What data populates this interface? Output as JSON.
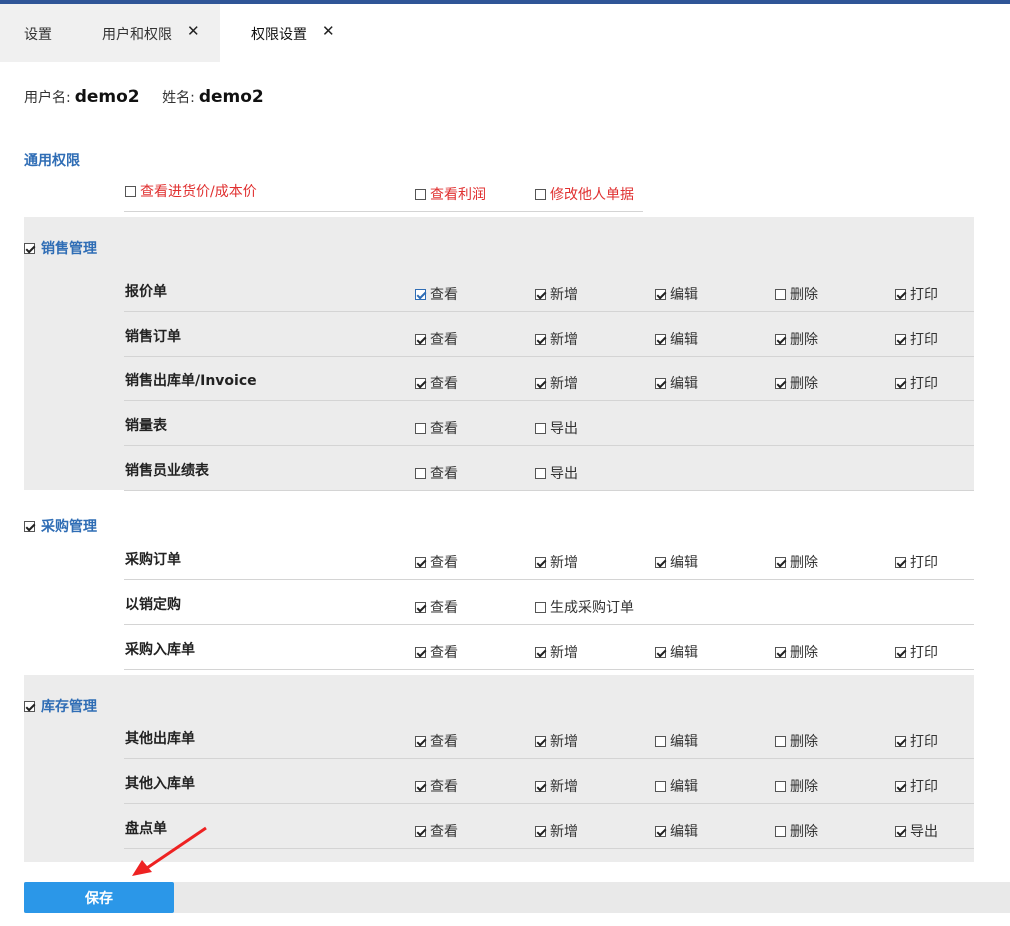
{
  "tabs": [
    {
      "label": "设置"
    },
    {
      "label": "用户和权限",
      "close": "✕"
    },
    {
      "label": "权限设置",
      "close": "✕"
    }
  ],
  "user": {
    "username_label": "用户名:",
    "username": "demo2",
    "name_label": "姓名:",
    "name": "demo2"
  },
  "general": {
    "title": "通用权限",
    "options": [
      {
        "label": "查看进货价/成本价",
        "checked": false
      },
      {
        "label": "查看利润",
        "checked": false
      },
      {
        "label": "修改他人单据",
        "checked": false
      }
    ]
  },
  "sections": [
    {
      "title": "销售管理",
      "checked": true,
      "rows": [
        {
          "name": "报价单",
          "perms": [
            {
              "label": "查看",
              "checked": true
            },
            {
              "label": "新增",
              "checked": true
            },
            {
              "label": "编辑",
              "checked": true
            },
            {
              "label": "删除",
              "checked": false
            },
            {
              "label": "打印",
              "checked": true
            }
          ]
        },
        {
          "name": "销售订单",
          "perms": [
            {
              "label": "查看",
              "checked": true
            },
            {
              "label": "新增",
              "checked": true
            },
            {
              "label": "编辑",
              "checked": true
            },
            {
              "label": "删除",
              "checked": true
            },
            {
              "label": "打印",
              "checked": true
            }
          ]
        },
        {
          "name": "销售出库单/Invoice",
          "perms": [
            {
              "label": "查看",
              "checked": true
            },
            {
              "label": "新增",
              "checked": true
            },
            {
              "label": "编辑",
              "checked": true
            },
            {
              "label": "删除",
              "checked": true
            },
            {
              "label": "打印",
              "checked": true
            }
          ]
        },
        {
          "name": "销量表",
          "perms": [
            {
              "label": "查看",
              "checked": false
            },
            {
              "label": "导出",
              "checked": false
            }
          ]
        },
        {
          "name": "销售员业绩表",
          "perms": [
            {
              "label": "查看",
              "checked": false
            },
            {
              "label": "导出",
              "checked": false
            }
          ]
        }
      ]
    },
    {
      "title": "采购管理",
      "checked": true,
      "rows": [
        {
          "name": "采购订单",
          "perms": [
            {
              "label": "查看",
              "checked": true
            },
            {
              "label": "新增",
              "checked": true
            },
            {
              "label": "编辑",
              "checked": true
            },
            {
              "label": "删除",
              "checked": true
            },
            {
              "label": "打印",
              "checked": true
            }
          ]
        },
        {
          "name": "以销定购",
          "perms": [
            {
              "label": "查看",
              "checked": true
            },
            {
              "label": "生成采购订单",
              "checked": false
            }
          ]
        },
        {
          "name": "采购入库单",
          "perms": [
            {
              "label": "查看",
              "checked": true
            },
            {
              "label": "新增",
              "checked": true
            },
            {
              "label": "编辑",
              "checked": true
            },
            {
              "label": "删除",
              "checked": true
            },
            {
              "label": "打印",
              "checked": true
            }
          ]
        }
      ]
    },
    {
      "title": "库存管理",
      "checked": true,
      "rows": [
        {
          "name": "其他出库单",
          "perms": [
            {
              "label": "查看",
              "checked": true
            },
            {
              "label": "新增",
              "checked": true
            },
            {
              "label": "编辑",
              "checked": false
            },
            {
              "label": "删除",
              "checked": false
            },
            {
              "label": "打印",
              "checked": true
            }
          ]
        },
        {
          "name": "其他入库单",
          "perms": [
            {
              "label": "查看",
              "checked": true
            },
            {
              "label": "新增",
              "checked": true
            },
            {
              "label": "编辑",
              "checked": false
            },
            {
              "label": "删除",
              "checked": false
            },
            {
              "label": "打印",
              "checked": true
            }
          ]
        },
        {
          "name": "盘点单",
          "perms": [
            {
              "label": "查看",
              "checked": true
            },
            {
              "label": "新增",
              "checked": true
            },
            {
              "label": "编辑",
              "checked": true
            },
            {
              "label": "删除",
              "checked": false
            },
            {
              "label": "导出",
              "checked": true
            }
          ]
        }
      ]
    }
  ],
  "save_button": "保存",
  "colors": {
    "accent": "#2f6db5",
    "button": "#2b97e8",
    "warning_text": "#e03030",
    "band": "#ececec"
  }
}
